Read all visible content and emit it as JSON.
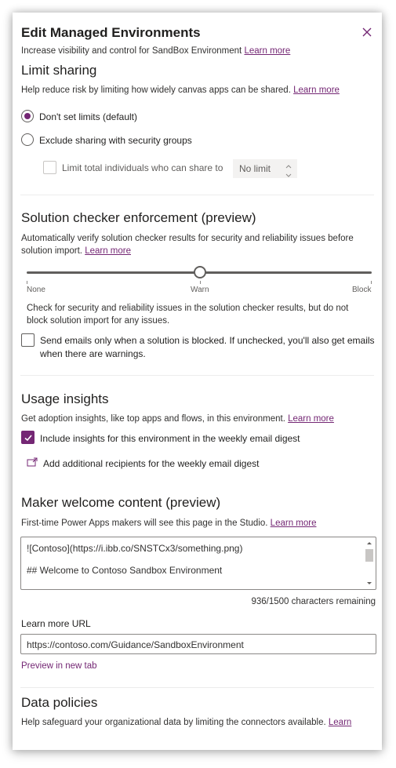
{
  "panel": {
    "title": "Edit Managed Environments",
    "subtitle": "Increase visibility and control for SandBox Environment",
    "subtitle_link": "Learn more",
    "close_icon": "close-icon"
  },
  "limit_sharing": {
    "heading": "Limit sharing",
    "description": "Help reduce risk by limiting how widely canvas apps can be shared.",
    "link": "Learn more",
    "options": [
      {
        "label": "Don't set limits (default)",
        "selected": true
      },
      {
        "label": "Exclude sharing with security groups",
        "selected": false
      }
    ],
    "limit_individuals_label": "Limit total individuals who can share to",
    "limit_value": "No limit"
  },
  "solution_checker": {
    "heading": "Solution checker enforcement (preview)",
    "description_line1": "Automatically verify solution checker results for security and reliability issues before",
    "description_line2": "solution import.",
    "link": "Learn more",
    "slider_labels": [
      "None",
      "Warn",
      "Block"
    ],
    "slider_value": "Warn",
    "level_description_line1": "Check for security and reliability issues in the solution checker results, but do not",
    "level_description_line2": "block solution import for any issues.",
    "email_checkbox_line1": "Send emails only when a solution is blocked. If unchecked, you'll also get emails",
    "email_checkbox_line2": "when there are warnings.",
    "email_checked": false
  },
  "usage_insights": {
    "heading": "Usage insights",
    "description": "Get adoption insights, like top apps and flows, in this environment.",
    "link": "Learn more",
    "include_label": "Include insights for this environment in the weekly email digest",
    "include_checked": true,
    "add_recipients_label": "Add additional recipients for the weekly email digest"
  },
  "maker_welcome": {
    "heading": "Maker welcome content (preview)",
    "description": "First-time Power Apps makers will see this page in the Studio.",
    "link": "Learn more",
    "content_line1": "![Contoso](https://i.ibb.co/SNSTCx3/something.png)",
    "content_line2": "## Welcome to Contoso Sandbox Environment",
    "char_count": "936/1500 characters remaining",
    "learn_more_url_label": "Learn more URL",
    "learn_more_url_value": "https://contoso.com/Guidance/SandboxEnvironment",
    "preview_link": "Preview in new tab"
  },
  "data_policies": {
    "heading": "Data policies",
    "description": "Help safeguard your organizational data by limiting the connectors available.",
    "link": "Learn"
  },
  "colors": {
    "accent": "#742774",
    "text": "#323130",
    "border": "#8a8886"
  }
}
